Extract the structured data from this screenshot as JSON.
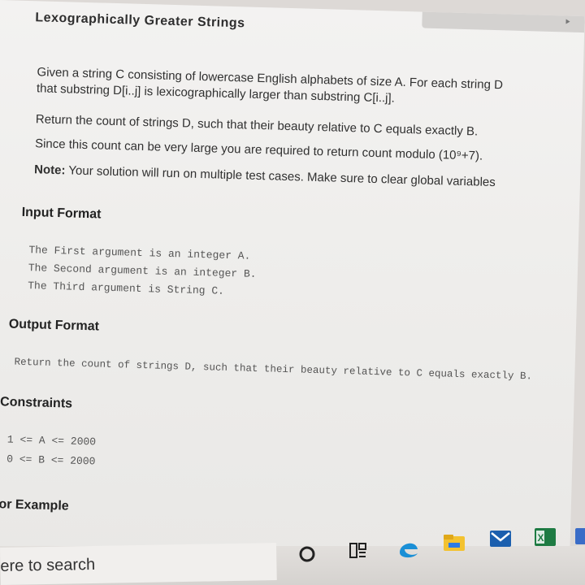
{
  "header": {
    "title": "Lexographically Greater Strings"
  },
  "description": {
    "line1": "Given a string C consisting of lowercase English alphabets of size A. For each string D",
    "line2": "that substring D[i..j] is lexicographically larger than substring C[i..j].",
    "line3": "Return the count of strings D, such that their beauty relative to C equals exactly B.",
    "line4": "Since this count can be very large you are required to return count modulo (10⁹+7).",
    "line5_bold": "Note:",
    "line5": " Your solution will run on multiple test cases. Make sure to clear global variables"
  },
  "input_format": {
    "heading": "Input Format",
    "lines": [
      "The First argument is an integer A.",
      "The Second argument is an integer B.",
      "The Third argument is String C."
    ]
  },
  "output_format": {
    "heading": "Output Format",
    "line": "Return the count of strings D, such that their beauty relative to C equals exactly B."
  },
  "constraints": {
    "heading": "Constraints",
    "lines": [
      "1 <= A <= 2000",
      "0 <= B <= 2000"
    ]
  },
  "example": {
    "heading": "For Example"
  },
  "taskbar": {
    "search_placeholder": "Type here to search",
    "search_visible": "ere to search",
    "icons": [
      "cortana-icon",
      "task-view-icon",
      "edge-icon",
      "file-explorer-icon",
      "mail-icon",
      "excel-icon"
    ]
  }
}
